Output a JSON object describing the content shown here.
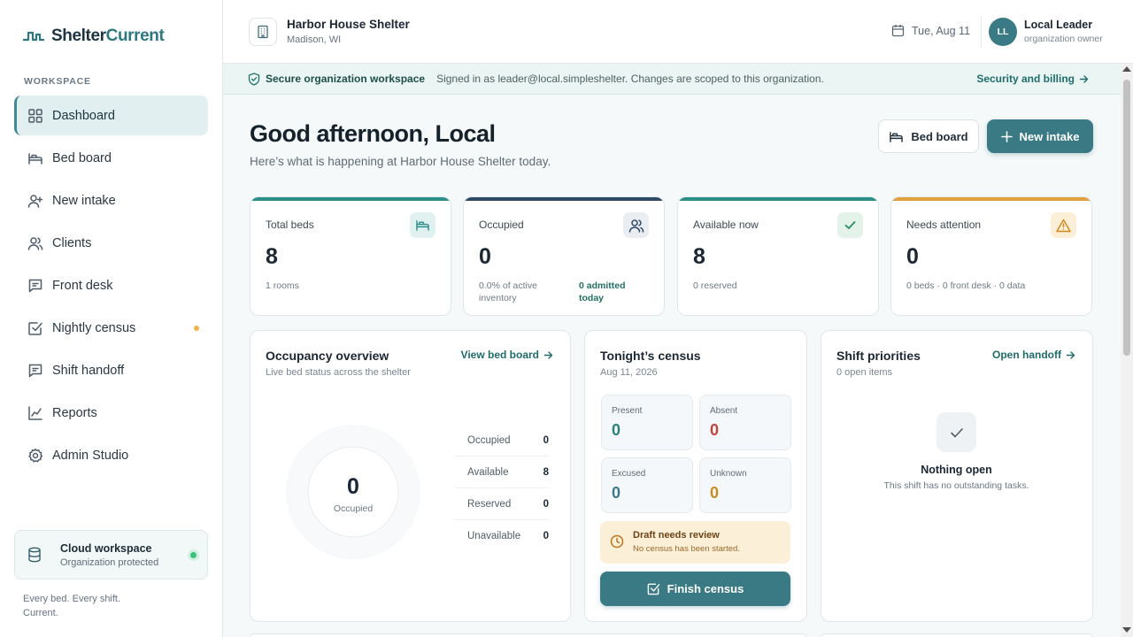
{
  "brand": {
    "name_part1": "Shelter",
    "name_part2": "Current"
  },
  "sidebar": {
    "section_label": "WORKSPACE",
    "items": [
      {
        "label": "Dashboard",
        "icon": "dashboard-grid-icon"
      },
      {
        "label": "Bed board",
        "icon": "bed-icon"
      },
      {
        "label": "New intake",
        "icon": "user-plus-icon"
      },
      {
        "label": "Clients",
        "icon": "users-icon"
      },
      {
        "label": "Front desk",
        "icon": "message-square-icon"
      },
      {
        "label": "Nightly census",
        "icon": "check-square-icon"
      },
      {
        "label": "Shift handoff",
        "icon": "message-square-icon"
      },
      {
        "label": "Reports",
        "icon": "line-chart-icon"
      },
      {
        "label": "Admin Studio",
        "icon": "gear-icon"
      }
    ],
    "cloud": {
      "title": "Cloud workspace",
      "subtitle": "Organization protected"
    },
    "tagline": "Every bed. Every shift. Current."
  },
  "header": {
    "org_name": "Harbor House Shelter",
    "org_location": "Madison, WI",
    "date": "Tue, Aug 11",
    "user": {
      "initials": "LL",
      "name": "Local Leader",
      "role": "organization owner"
    }
  },
  "security_banner": {
    "title": "Secure organization workspace",
    "text": "Signed in as leader@local.simpleshelter. Changes are scoped to this organization.",
    "link": "Security and billing"
  },
  "main": {
    "greeting": "Good afternoon, Local",
    "subtitle": "Here’s what is happening at Harbor House Shelter today.",
    "bed_board_button": "Bed board",
    "new_intake_button": "New intake"
  },
  "stats": [
    {
      "label": "Total beds",
      "value": "8",
      "note": "1 rooms",
      "accent": "#2a8f86",
      "icon": "bed-icon"
    },
    {
      "label": "Occupied",
      "value": "0",
      "note": "0.0% of active inventory",
      "note2": "0 admitted today",
      "accent": "#2f4a66",
      "icon": "users-icon"
    },
    {
      "label": "Available now",
      "value": "8",
      "note": "0 reserved",
      "accent": "#2a8f86",
      "icon": "check-icon"
    },
    {
      "label": "Needs attention",
      "value": "0",
      "note": "0 beds · 0 front desk · 0 data",
      "accent": "#e0a33c",
      "icon": "alert-triangle-icon"
    }
  ],
  "occupancy": {
    "title": "Occupancy overview",
    "subtitle": "Live bed status across the shelter",
    "link": "View bed board",
    "center_value": "0",
    "center_label": "Occupied",
    "legend": [
      {
        "label": "Occupied",
        "value": "0"
      },
      {
        "label": "Available",
        "value": "8"
      },
      {
        "label": "Reserved",
        "value": "0"
      },
      {
        "label": "Unavailable",
        "value": "0"
      }
    ]
  },
  "census": {
    "title": "Tonight’s census",
    "date": "Aug 11, 2026",
    "tiles": [
      {
        "label": "Present",
        "value": "0",
        "color": "#2a7f76"
      },
      {
        "label": "Absent",
        "value": "0",
        "color": "#c0443c"
      },
      {
        "label": "Excused",
        "value": "0",
        "color": "#3a7a85"
      },
      {
        "label": "Unknown",
        "value": "0",
        "color": "#c98a22"
      }
    ],
    "draft_title": "Draft needs review",
    "draft_text": "No census has been started.",
    "finish_button": "Finish census"
  },
  "shift": {
    "title": "Shift priorities",
    "subtitle": "0 open items",
    "link": "Open handoff",
    "empty_title": "Nothing open",
    "empty_text": "This shift has no outstanding tasks."
  }
}
